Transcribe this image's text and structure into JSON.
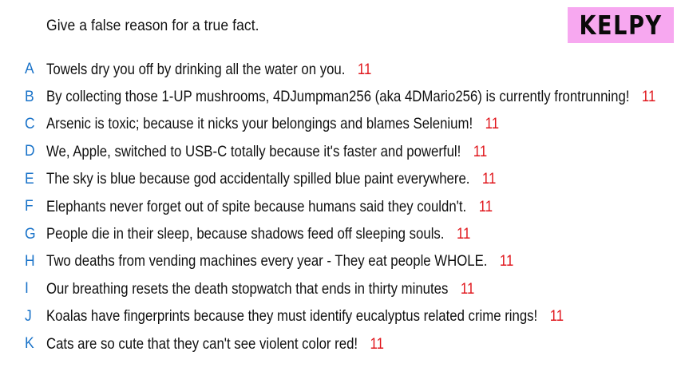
{
  "header": {
    "prompt": "Give a false reason for a true fact.",
    "logo": "KELPY"
  },
  "theme": {
    "letter_color": "#1a73c9",
    "vote_color": "#e0161c",
    "logo_bg": "#f7a8f0"
  },
  "answers": [
    {
      "letter": "A",
      "text": "Towels dry you off by drinking all the water on you.",
      "votes": "11"
    },
    {
      "letter": "B",
      "text": "By collecting those 1-UP mushrooms, 4DJumpman256 (aka 4DMario256) is currently frontrunning!",
      "votes": "11"
    },
    {
      "letter": "C",
      "text": "Arsenic is toxic; because it nicks your belongings and blames Selenium!",
      "votes": "11"
    },
    {
      "letter": "D",
      "text": "We, Apple, switched to USB-C totally because it's faster and powerful!",
      "votes": "11"
    },
    {
      "letter": "E",
      "text": "The sky is blue because god accidentally spilled blue paint everywhere.",
      "votes": "11"
    },
    {
      "letter": "F",
      "text": "Elephants never forget out of spite because humans said they couldn't.",
      "votes": "11"
    },
    {
      "letter": "G",
      "text": "People die in their sleep, because shadows feed off sleeping souls.",
      "votes": "11"
    },
    {
      "letter": "H",
      "text": "Two deaths from vending machines every year - They eat people WHOLE.",
      "votes": "11"
    },
    {
      "letter": "I",
      "text": "Our breathing resets the death stopwatch that ends in thirty minutes",
      "votes": "11"
    },
    {
      "letter": "J",
      "text": "Koalas have fingerprints because they must identify eucalyptus related crime rings!",
      "votes": "11"
    },
    {
      "letter": "K",
      "text": "Cats are so cute that they can't see violent color red!",
      "votes": "11"
    }
  ]
}
